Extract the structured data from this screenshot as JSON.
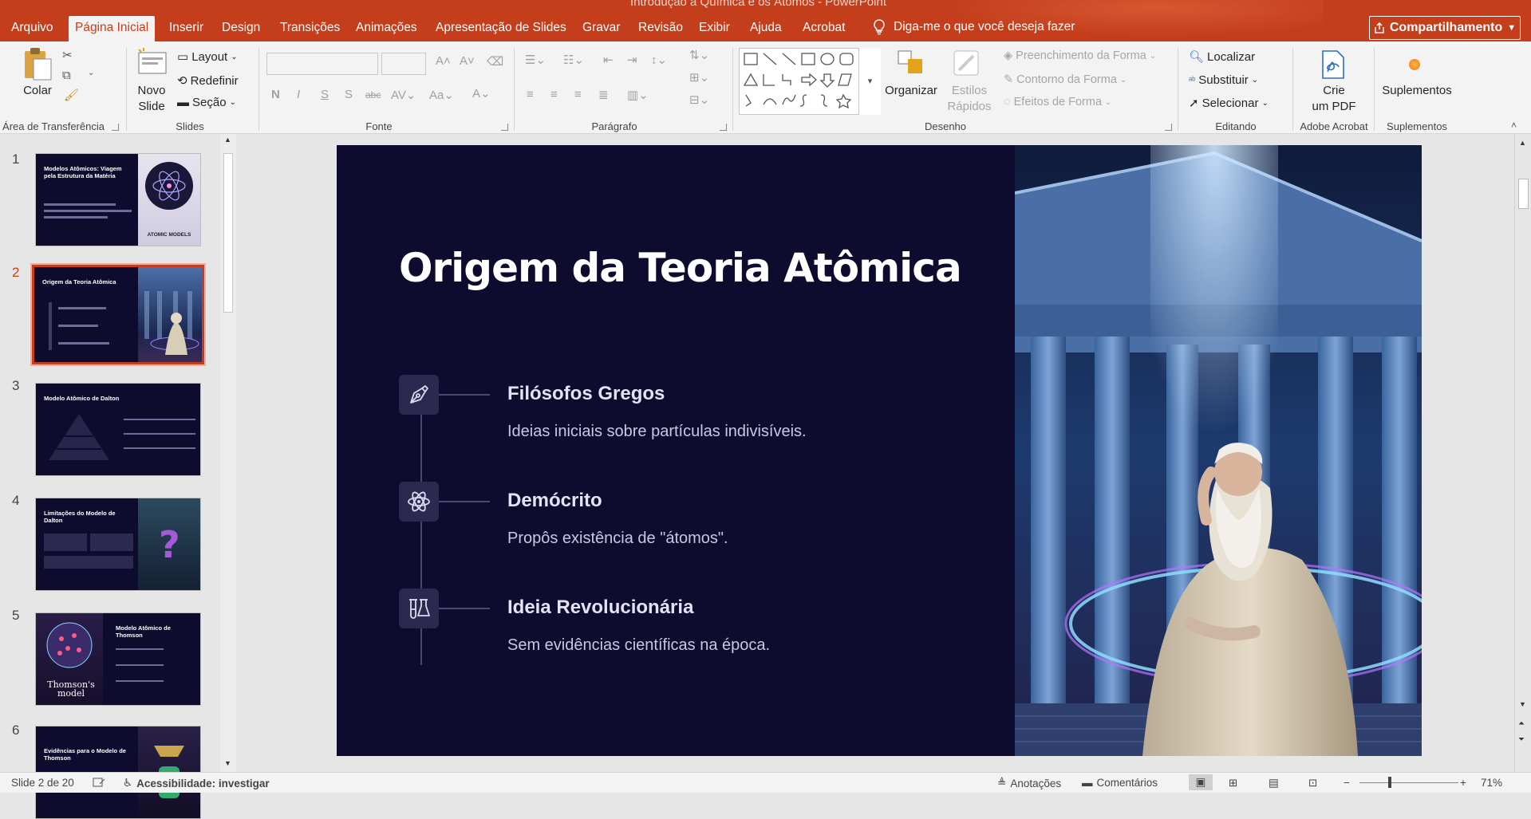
{
  "window": {
    "doc_title": "Introdução à Química e os Átomos  -  PowerPoint"
  },
  "tabs": [
    {
      "label": "Arquivo"
    },
    {
      "label": "Página Inicial"
    },
    {
      "label": "Inserir"
    },
    {
      "label": "Design"
    },
    {
      "label": "Transições"
    },
    {
      "label": "Animações"
    },
    {
      "label": "Apresentação de Slides"
    },
    {
      "label": "Gravar"
    },
    {
      "label": "Revisão"
    },
    {
      "label": "Exibir"
    },
    {
      "label": "Ajuda"
    },
    {
      "label": "Acrobat"
    }
  ],
  "tellme": {
    "placeholder": "Diga-me o que você deseja fazer"
  },
  "share": {
    "label": "Compartilhamento"
  },
  "ribbon": {
    "clipboard": {
      "paste": "Colar",
      "group": "Área de Transferência"
    },
    "slides": {
      "new_slide_1": "Novo",
      "new_slide_2": "Slide",
      "layout": "Layout",
      "reset": "Redefinir",
      "section": "Seção",
      "group": "Slides"
    },
    "font": {
      "group": "Fonte"
    },
    "paragraph": {
      "group": "Parágrafo"
    },
    "drawing": {
      "arrange": "Organizar",
      "quick_styles_1": "Estilos",
      "quick_styles_2": "Rápidos",
      "shape_fill": "Preenchimento da Forma",
      "shape_outline": "Contorno da Forma",
      "shape_effects": "Efeitos de Forma",
      "group": "Desenho"
    },
    "editing": {
      "find": "Localizar",
      "replace": "Substituir",
      "select": "Selecionar",
      "group": "Editando"
    },
    "acrobat": {
      "create_1": "Crie",
      "create_2": "um PDF",
      "group": "Adobe Acrobat"
    },
    "addins": {
      "label": "Suplementos",
      "group": "Suplementos"
    }
  },
  "thumbnails": [
    {
      "num": "1",
      "title": "Modelos Atômicos: Viagem pela Estrutura da Matéria",
      "caption": "ATOMIC MODELS"
    },
    {
      "num": "2",
      "title": "Origem da Teoria Atômica"
    },
    {
      "num": "3",
      "title": "Modelo Atômico de Dalton"
    },
    {
      "num": "4",
      "title": "Limitações do Modelo de Dalton"
    },
    {
      "num": "5",
      "title": "Modelo Atômico de Thomson",
      "caption": "Thomson's model"
    },
    {
      "num": "6",
      "title": "Evidências para o Modelo de Thomson"
    }
  ],
  "slide": {
    "title": "Origem da Teoria Atômica",
    "items": [
      {
        "heading": "Filósofos Gregos",
        "text": "Ideias iniciais sobre partículas indivisíveis.",
        "icon": "pen-nib-icon"
      },
      {
        "heading": "Demócrito",
        "text": "Propôs existência de \"átomos\".",
        "icon": "atom-icon"
      },
      {
        "heading": "Ideia Revolucionária",
        "text": "Sem evidências científicas na época.",
        "icon": "flask-icon"
      }
    ]
  },
  "status": {
    "slide_count": "Slide 2 de 20",
    "accessibility": "Acessibilidade: investigar",
    "notes": "Anotações",
    "comments": "Comentários",
    "zoom": "71%"
  }
}
